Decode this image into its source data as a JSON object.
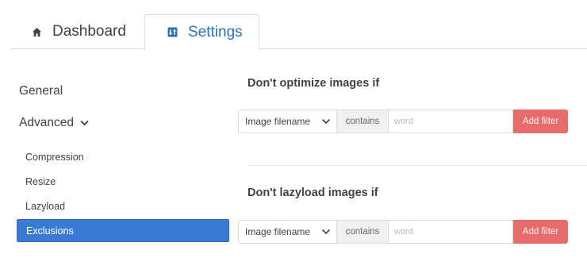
{
  "tabs": {
    "dashboard": {
      "label": "Dashboard",
      "icon": "home-icon"
    },
    "settings": {
      "label": "Settings",
      "icon": "settings-icon",
      "active": true
    }
  },
  "sidebar": {
    "general": "General",
    "advanced": "Advanced",
    "items": [
      {
        "label": "Compression"
      },
      {
        "label": "Resize"
      },
      {
        "label": "Lazyload"
      },
      {
        "label": "Exclusions",
        "active": true
      }
    ]
  },
  "sections": [
    {
      "title": "Don't optimize images if",
      "select_value": "Image filename",
      "operator": "contains",
      "input_value": "",
      "input_placeholder": "word",
      "button_label": "Add filter"
    },
    {
      "title": "Don't lazyload images if",
      "select_value": "Image filename",
      "operator": "contains",
      "input_value": "",
      "input_placeholder": "word",
      "button_label": "Add filter"
    }
  ],
  "colors": {
    "accent": "#2b72b8",
    "active_item": "#3a7bd5",
    "button": "#e86b6b"
  }
}
